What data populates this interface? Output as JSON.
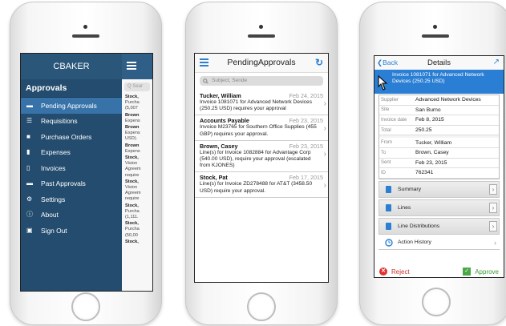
{
  "phone1": {
    "title": "CBAKER",
    "section": "Approvals",
    "items": [
      {
        "label": "Pending Approvals",
        "icon": "folder-icon",
        "active": true
      },
      {
        "label": "Requisitions",
        "icon": "cart-icon"
      },
      {
        "label": "Purchase Orders",
        "icon": "briefcase-icon"
      },
      {
        "label": "Expenses",
        "icon": "card-icon"
      },
      {
        "label": "Invoices",
        "icon": "document-icon"
      },
      {
        "label": "Past Approvals",
        "icon": "check-folder-icon"
      },
      {
        "label": "Settings",
        "icon": "gear-icon"
      },
      {
        "label": "About",
        "icon": "info-icon"
      },
      {
        "label": "Sign Out",
        "icon": "signout-icon"
      }
    ],
    "peek_search": "Q Sear",
    "peek_lines": [
      {
        "t": "Stock,",
        "b": true
      },
      {
        "t": "Purcha"
      },
      {
        "t": "(5,007"
      },
      {
        "t": "Brown",
        "b": true
      },
      {
        "t": "Expens"
      },
      {
        "t": "Brown",
        "b": true
      },
      {
        "t": "Expens"
      },
      {
        "t": "USD)."
      },
      {
        "t": "Brown",
        "b": true
      },
      {
        "t": "Expens"
      },
      {
        "t": "Stock,",
        "b": true
      },
      {
        "t": "Vision"
      },
      {
        "t": "Agreem"
      },
      {
        "t": "require"
      },
      {
        "t": "Stock,",
        "b": true
      },
      {
        "t": "Vision"
      },
      {
        "t": "Agreem"
      },
      {
        "t": "require"
      },
      {
        "t": "Stock,",
        "b": true
      },
      {
        "t": "Purcha"
      },
      {
        "t": "(1,111."
      },
      {
        "t": "Stock,",
        "b": true
      },
      {
        "t": "Purcha"
      },
      {
        "t": "(50,00"
      },
      {
        "t": "Stock,",
        "b": true
      }
    ]
  },
  "phone2": {
    "title": "PendingApprovals",
    "search_placeholder": "Subject, Sende",
    "approvals": [
      {
        "name": "Tucker, William",
        "date": "Feb 24, 2015",
        "desc": "Invoice 1081071 for Advanced Network Devices (250.25 USD) requires your approval"
      },
      {
        "name": "Accounts Payable",
        "date": "Feb 23, 2015",
        "desc": "Invoice M23765 for Southern Office Supplies (455 GBP) requires your approval."
      },
      {
        "name": "Brown, Casey",
        "date": "Feb 23, 2015",
        "desc": "Line(s) for Invoice 1082884 for Advantage Corp (540.00 USD), require your approval (escalated from KJONES)"
      },
      {
        "name": "Stock, Pat",
        "date": "Feb 17, 2015",
        "desc": "Line(s) for Invoice ZD278488 for AT&T (3458.50 USD) require your approval."
      }
    ]
  },
  "phone3": {
    "back_label": "Back",
    "title": "Details",
    "banner": "Invoice 1081071 for Advanced Network Devices (250.25 USD)",
    "rows1": [
      {
        "label": "Supplier",
        "value": "Advanced Network Devices"
      },
      {
        "label": "Site",
        "value": "San Burno"
      },
      {
        "label": "Invoice date",
        "value": "Feb 8, 2015"
      },
      {
        "label": "Total",
        "value": "250.25"
      }
    ],
    "rows2": [
      {
        "label": "From",
        "value": "Tucker, William"
      },
      {
        "label": "To",
        "value": "Brown, Casey"
      },
      {
        "label": "Sent",
        "value": "Feb 23, 2015"
      },
      {
        "label": "ID",
        "value": "762341"
      }
    ],
    "sections": [
      "Summary",
      "Lines",
      "Line Distributions"
    ],
    "action_history": "Action History",
    "reject_label": "Reject",
    "approve_label": "Approve"
  }
}
